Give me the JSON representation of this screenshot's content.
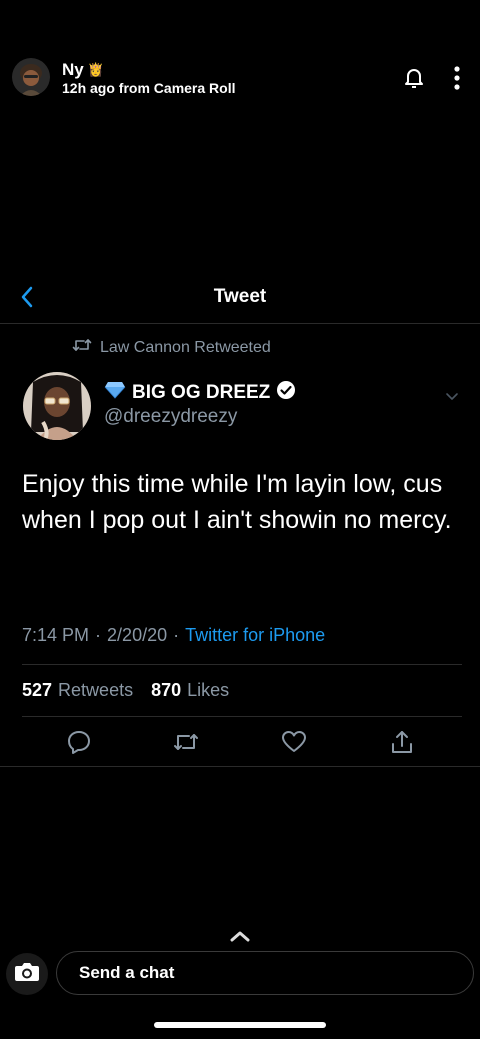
{
  "story": {
    "user_name": "Ny",
    "crown_glyph": "👸",
    "time_source": "12h ago from Camera Roll",
    "icons": {
      "notify": "bell-icon",
      "more": "more-vertical-icon"
    }
  },
  "tweet": {
    "nav_title": "Tweet",
    "retweeted_by": "Law Cannon Retweeted",
    "display_name": "BIG OG DREEZ",
    "handle": "@dreezydreezy",
    "text": "Enjoy this time while I'm layin low, cus when I pop out I ain't showin no mercy.",
    "time": "7:14 PM",
    "date": "2/20/20",
    "separator": "·",
    "source": "Twitter for iPhone",
    "retweets_count": "527",
    "retweets_label": "Retweets",
    "likes_count": "870",
    "likes_label": "Likes",
    "colors": {
      "link": "#1d9bf0",
      "muted": "#8b98a5",
      "diamond": "#5aa9f0"
    }
  },
  "chat": {
    "placeholder": "Send a chat"
  }
}
